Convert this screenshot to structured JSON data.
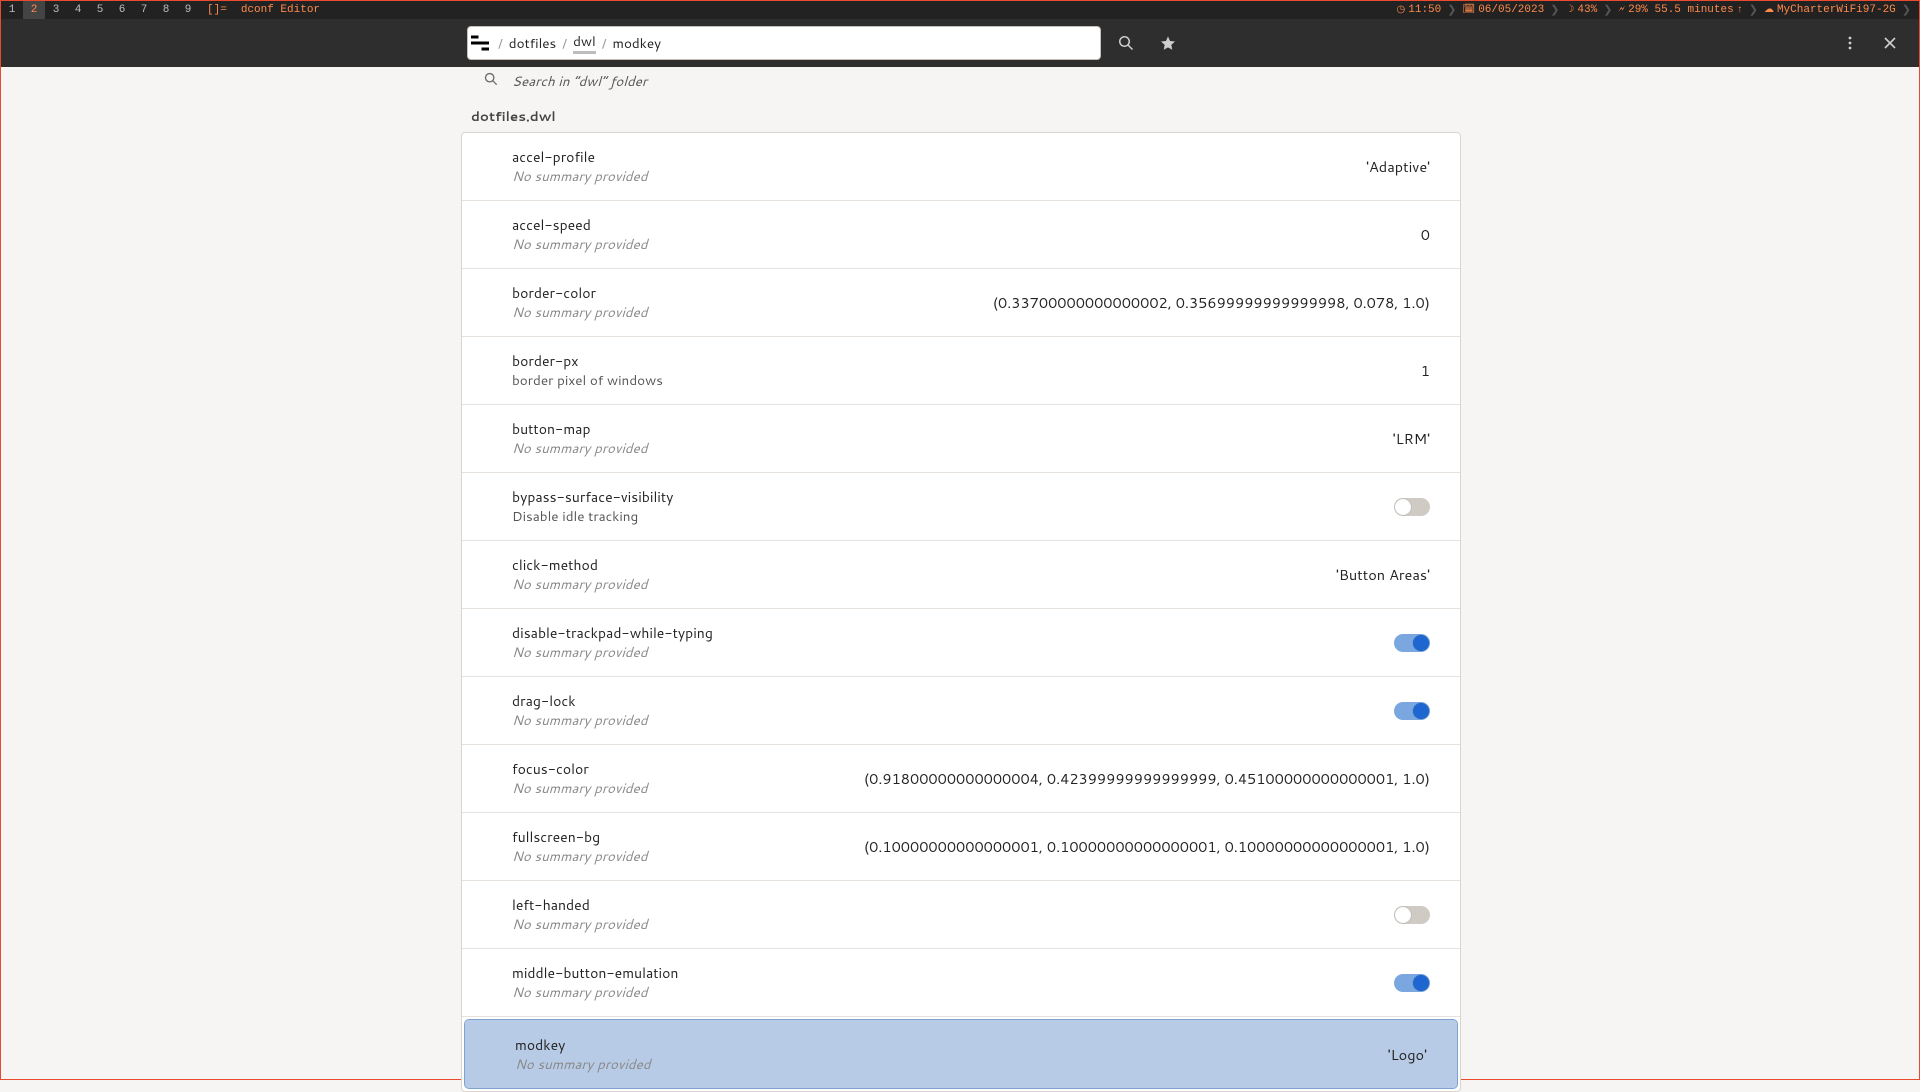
{
  "topbar": {
    "workspaces": [
      "1",
      "2",
      "3",
      "4",
      "5",
      "6",
      "7",
      "8",
      "9"
    ],
    "active_workspace": 1,
    "tag_mode": "[]=",
    "app_title": "dconf Editor",
    "time": "11:50",
    "date": "06/05/2023",
    "brightness": "43%",
    "battery": "29% 55.5 minutes",
    "wifi": "MyCharterWiFi97-2G"
  },
  "header": {
    "breadcrumbs": [
      "dotfiles",
      "dwl",
      "modkey"
    ]
  },
  "search": {
    "placeholder": "Search in “dwl” folder"
  },
  "section_label": "dotfiles.dwl",
  "keys": [
    {
      "name": "accel-profile",
      "summary": "No summary provided",
      "summary_italic": true,
      "type": "text",
      "value": "'Adaptive'",
      "selected": false
    },
    {
      "name": "accel-speed",
      "summary": "No summary provided",
      "summary_italic": true,
      "type": "text",
      "value": "0",
      "selected": false
    },
    {
      "name": "border-color",
      "summary": "No summary provided",
      "summary_italic": true,
      "type": "text",
      "value": "(0.33700000000000002, 0.35699999999999998, 0.078, 1.0)",
      "selected": false
    },
    {
      "name": "border-px",
      "summary": "border pixel of windows",
      "summary_italic": false,
      "type": "text",
      "value": "1",
      "selected": false
    },
    {
      "name": "button-map",
      "summary": "No summary provided",
      "summary_italic": true,
      "type": "text",
      "value": "'LRM'",
      "selected": false
    },
    {
      "name": "bypass-surface-visibility",
      "summary": "Disable idle tracking",
      "summary_italic": false,
      "type": "switch",
      "value": false,
      "selected": false
    },
    {
      "name": "click-method",
      "summary": "No summary provided",
      "summary_italic": true,
      "type": "text",
      "value": "'Button Areas'",
      "selected": false
    },
    {
      "name": "disable-trackpad-while-typing",
      "summary": "No summary provided",
      "summary_italic": true,
      "type": "switch",
      "value": true,
      "selected": false
    },
    {
      "name": "drag-lock",
      "summary": "No summary provided",
      "summary_italic": true,
      "type": "switch",
      "value": true,
      "selected": false
    },
    {
      "name": "focus-color",
      "summary": "No summary provided",
      "summary_italic": true,
      "type": "text",
      "value": "(0.91800000000000004, 0.42399999999999999, 0.45100000000000001, 1.0)",
      "selected": false
    },
    {
      "name": "fullscreen-bg",
      "summary": "No summary provided",
      "summary_italic": true,
      "type": "text",
      "value": "(0.10000000000000001, 0.10000000000000001, 0.10000000000000001, 1.0)",
      "selected": false
    },
    {
      "name": "left-handed",
      "summary": "No summary provided",
      "summary_italic": true,
      "type": "switch",
      "value": false,
      "selected": false
    },
    {
      "name": "middle-button-emulation",
      "summary": "No summary provided",
      "summary_italic": true,
      "type": "switch",
      "value": true,
      "selected": false
    },
    {
      "name": "modkey",
      "summary": "No summary provided",
      "summary_italic": true,
      "type": "text",
      "value": "'Logo'",
      "selected": true
    }
  ]
}
